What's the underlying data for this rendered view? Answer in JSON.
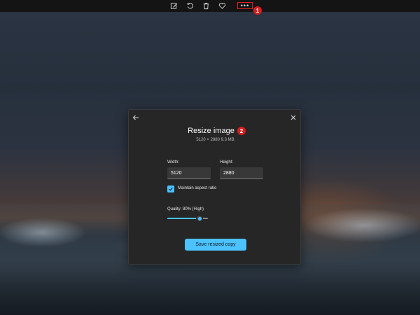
{
  "toolbar": {
    "icons": [
      "edit-image-icon",
      "rotate-icon",
      "delete-icon",
      "favorite-icon"
    ],
    "more_label": "•••",
    "more_badge": "1"
  },
  "dialog": {
    "title": "Resize image",
    "title_badge": "2",
    "subtitle": "5120 × 2880    9.3 MB",
    "width_label": "Width:",
    "width_value": "5120",
    "height_label": "Height:",
    "height_value": "2880",
    "maintain_aspect_label": "Maintain aspect ratio",
    "maintain_aspect_checked": true,
    "quality_label": "Quality: 80% (High)",
    "quality_value": 0.8,
    "save_button": "Save resized copy"
  },
  "colors": {
    "accent": "#4cc2ff",
    "badge": "#d81e1e",
    "dialog_bg": "#262626"
  }
}
